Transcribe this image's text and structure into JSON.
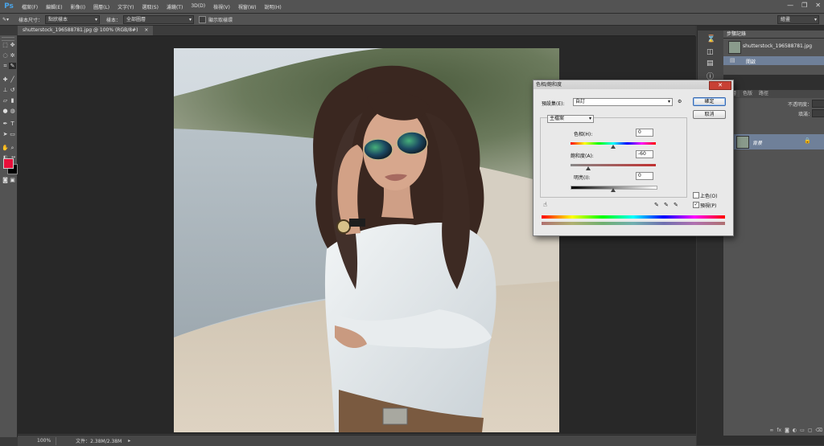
{
  "app": {
    "logo": "Ps"
  },
  "menu": [
    "檔案(F)",
    "編輯(E)",
    "影像(I)",
    "圖層(L)",
    "文字(Y)",
    "選取(S)",
    "濾鏡(T)",
    "3D(D)",
    "檢視(V)",
    "視窗(W)",
    "說明(H)"
  ],
  "window_controls": {
    "minimize": "—",
    "maximize": "❐",
    "close": "✕"
  },
  "options_bar": {
    "sample_size_label": "樣本尺寸：",
    "sample_size_value": "點狀樣本",
    "sample_label": "樣本：",
    "sample_value": "全部圖層",
    "show_ring_label": "顯示取樣環",
    "workspace_value": "繪畫"
  },
  "document_tab": {
    "title": "shutterstock_196588781.jpg @ 100% (RGB/8#)",
    "close": "×"
  },
  "status_bar": {
    "zoom": "100%",
    "doc_info": "文件：2.38M/2.38M",
    "arrow": "▸"
  },
  "history_panel": {
    "tab": "步驟記錄",
    "snapshot_name": "shutterstock_196588781.jpg",
    "step_name": "開啟"
  },
  "layers_panel": {
    "tabs": [
      "圖層",
      "色版",
      "路徑"
    ],
    "opacity_label": "不透明度：",
    "fill_label": "填滿：",
    "layer_name": "背景"
  },
  "dialog": {
    "title": "色相/飽和度",
    "close": "✕",
    "preset_label": "預設集(E):",
    "preset_value": "自訂",
    "ok": "確定",
    "cancel": "取消",
    "channel_value": "主檔案",
    "hue_label": "色相(H):",
    "hue_value": "0",
    "saturation_label": "飽和度(A):",
    "saturation_value": "-60",
    "lightness_label": "明亮(I):",
    "lightness_value": "0",
    "colorize_label": "上色(O)",
    "colorize_checked": false,
    "preview_label": "預視(P)",
    "preview_checked": true
  },
  "colors": {
    "foreground": "#e8103a",
    "background": "#000000",
    "ps_blue": "#4aa4e8"
  }
}
